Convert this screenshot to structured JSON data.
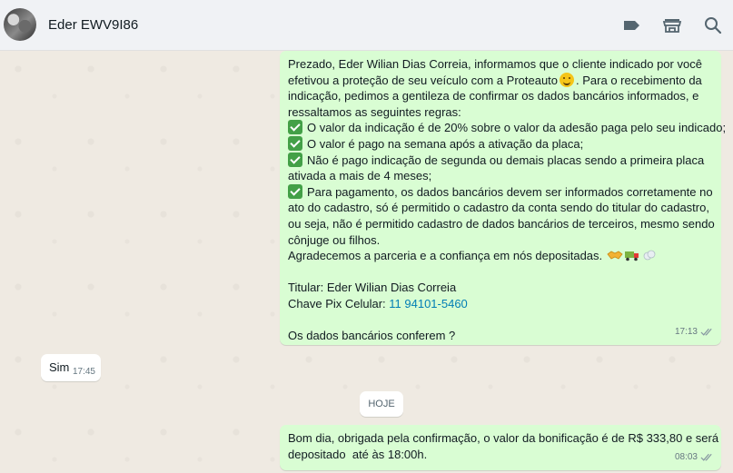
{
  "header": {
    "contact_name": "Eder EWV9I86",
    "icons": [
      "label-icon",
      "store-icon",
      "search-icon"
    ]
  },
  "messages": [
    {
      "direction": "outgoing",
      "lines": {
        "l1": "Prezado, Eder Wilian Dias Correia, informamos que o cliente indicado por você",
        "l2a": "efetivou a proteção de seu veículo com a Proteauto",
        "l2b": ". Para o recebimento da",
        "l3": "indicação, pedimos a gentileza de confirmar os dados bancários informados, e",
        "l4": "ressaltamos as seguintes regras:",
        "r1": "O valor da indicação é de 20% sobre o valor da adesão paga pelo seu indicado;",
        "r2": "O valor é pago na semana após a ativação da placa;",
        "r3a": "Não é pago indicação de segunda ou demais placas sendo a primeira placa",
        "r3b": "ativada a mais de 4 meses;",
        "r4a": "Para pagamento, os dados bancários devem ser informados corretamente no",
        "r4b": "ato do cadastro, só é permitido o cadastro da conta sendo do titular do cadastro,",
        "r4c": "ou seja, não é permitido cadastro de dados bancários de terceiros, mesmo sendo",
        "r4d": "cônjuge ou filhos.",
        "thanks": "Agradecemos a parceria e a confiança em nós depositadas.",
        "titular": "Titular: Eder Wilian Dias Correia",
        "pix_label": "Chave Pix Celular: ",
        "pix_value": "11 94101-5460",
        "confirm": "Os dados bancários conferem ?"
      },
      "time": "17:13",
      "status": "read"
    },
    {
      "direction": "incoming",
      "text": "Sim",
      "time": "17:45"
    },
    {
      "direction": "outgoing",
      "lines": {
        "l1": "Bom dia, obrigada pela confirmação, o valor da bonificação é de R$ 333,80 e será",
        "l2": "depositado  até às 18:00h."
      },
      "time": "08:03",
      "status": "read"
    }
  ],
  "day_divider": "HOJE",
  "colors": {
    "outgoing_bubble": "#d9fdd3",
    "incoming_bubble": "#ffffff",
    "chat_background": "#efeae2",
    "link": "#027eb5",
    "read_ticks": "#8696a0"
  }
}
